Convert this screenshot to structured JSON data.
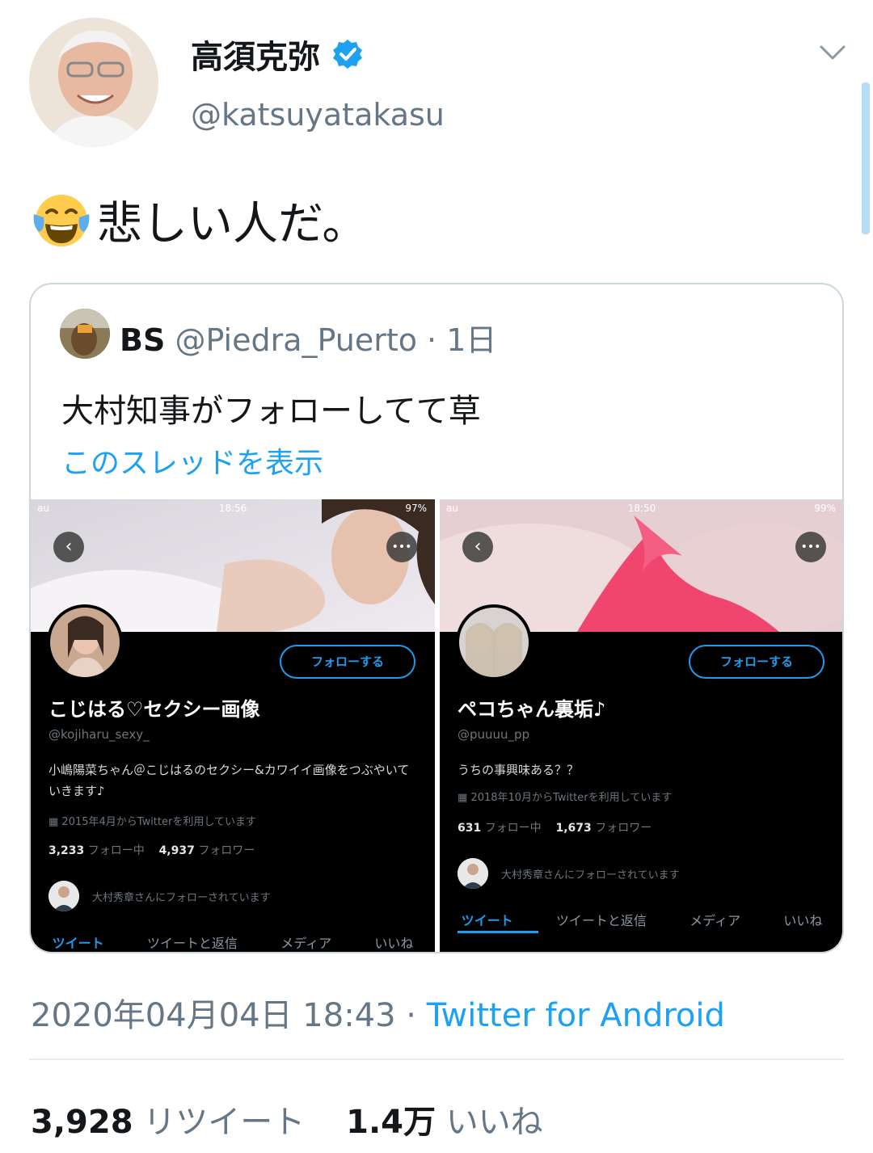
{
  "author": {
    "display_name": "高須克弥",
    "handle": "@katsuyatakasu",
    "verified": true
  },
  "tweet": {
    "emoji": "face-with-tears-of-joy",
    "text": "悲しい人だ。"
  },
  "quoted_tweet": {
    "name": "BS",
    "meta": "@Piedra_Puerto · 1日",
    "text": "大村知事がフォローしてて草",
    "show_thread_label": "このスレッドを表示",
    "screenshots": [
      {
        "status_carrier": "au",
        "status_time": "18:56",
        "status_battery": "97%",
        "follow_label": "フォローする",
        "name": "こじはる♡セクシー画像",
        "handle": "@kojiharu_sexy_",
        "bio": "小嶋陽菜ちゃん＠こじはるのセクシー&カワイイ画像をつぶやいていきます♪",
        "joined": "2015年4月からTwitterを利用しています",
        "following_count": "3,233",
        "following_label": "フォロー中",
        "followers_count": "4,937",
        "followers_label": "フォロワー",
        "followed_by": "大村秀章さんにフォローされています",
        "tabs": [
          "ツイート",
          "ツイートと返信",
          "メディア",
          "いいね"
        ]
      },
      {
        "status_carrier": "au",
        "status_time": "18:50",
        "status_battery": "99%",
        "follow_label": "フォローする",
        "name": "ペコちゃん裏垢♪",
        "handle": "@puuuu_pp",
        "bio": "うちの事興味ある？？",
        "joined": "2018年10月からTwitterを利用しています",
        "following_count": "631",
        "following_label": "フォロー中",
        "followers_count": "1,673",
        "followers_label": "フォロワー",
        "followed_by": "大村秀章さんにフォローされています",
        "tabs": [
          "ツイート",
          "ツイートと返信",
          "メディア",
          "いいね"
        ]
      }
    ]
  },
  "footer": {
    "date": "2020年04月04日 18:43 · ",
    "source": "Twitter for Android",
    "retweet_count": "3,928",
    "retweet_label": "リツイート",
    "like_count": "1.4万",
    "like_label": "いいね"
  },
  "colors": {
    "accent": "#1da1f2",
    "secondary_text": "#657786",
    "border": "#ccd6dd"
  }
}
